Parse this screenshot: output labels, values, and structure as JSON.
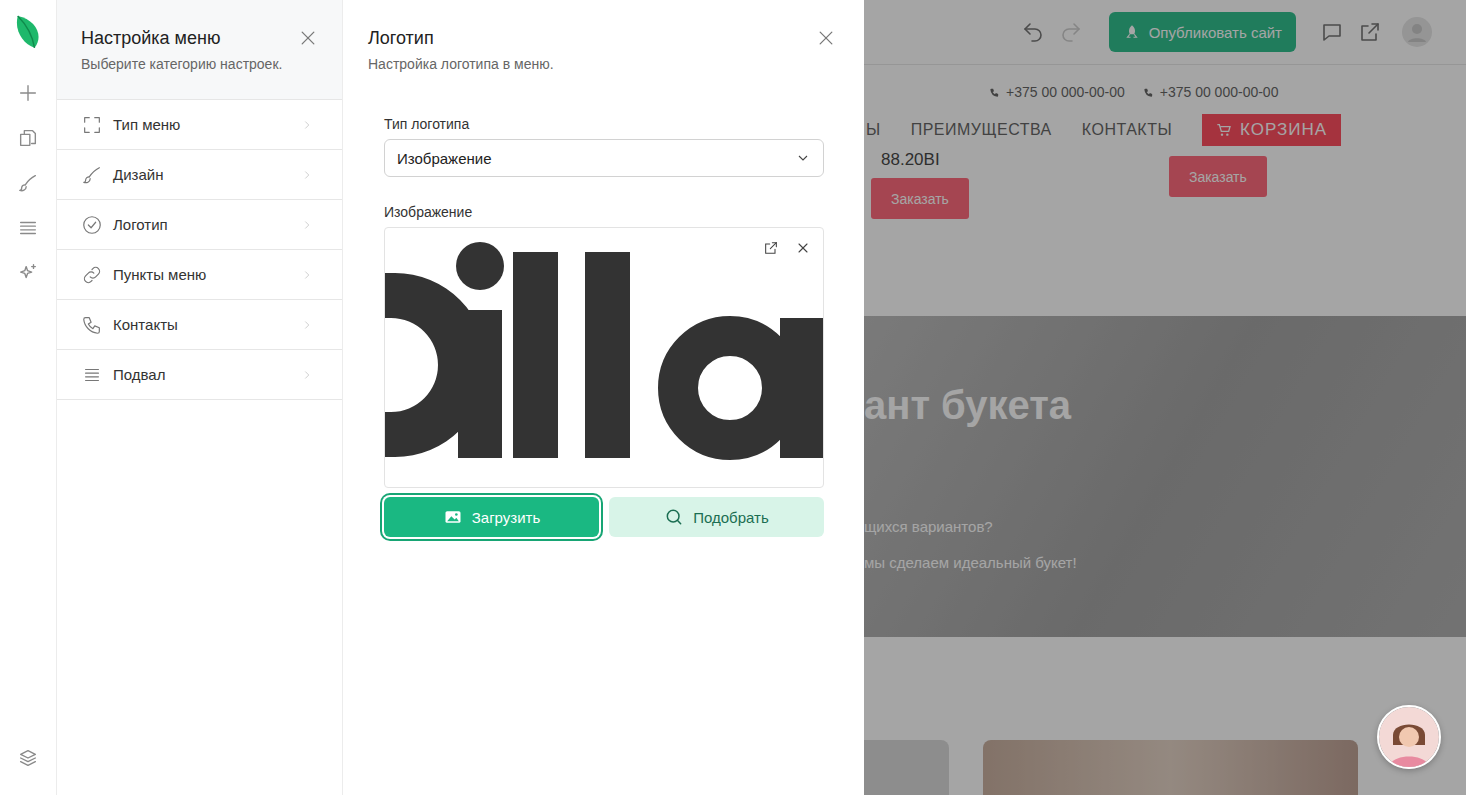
{
  "menu_panel": {
    "title": "Настройка меню",
    "subtitle": "Выберите категорию настроек.",
    "items": [
      {
        "label": "Тип меню"
      },
      {
        "label": "Дизайн"
      },
      {
        "label": "Логотип"
      },
      {
        "label": "Пункты меню"
      },
      {
        "label": "Контакты"
      },
      {
        "label": "Подвал"
      }
    ]
  },
  "logo_panel": {
    "title": "Логотип",
    "subtitle": "Настройка логотипа в меню.",
    "type_label": "Тип логотипа",
    "type_value": "Изображение",
    "image_label": "Изображение",
    "upload_button": {
      "label": "Загрузить",
      "focused": true
    },
    "pick_button": {
      "label": "Подобрать"
    }
  },
  "preview": {
    "undo": {
      "disabled": false
    },
    "redo": {
      "disabled": true
    },
    "publish_button": "Опубликовать сайт",
    "phones": [
      "+375 00 000-00-00",
      "+375 00 000-00-00"
    ],
    "nav": [
      "Ы",
      "ПРЕИМУЩЕСТВА",
      "КОНТАКТЫ"
    ],
    "cart_button": "КОРЗИНА",
    "price": "88.20BI",
    "order_buttons": [
      "Заказать",
      "Заказать"
    ],
    "hero": {
      "title": "ант букета",
      "lines": [
        "щихся вариантов?",
        "мы сделаем идеальный букет!"
      ]
    }
  }
}
